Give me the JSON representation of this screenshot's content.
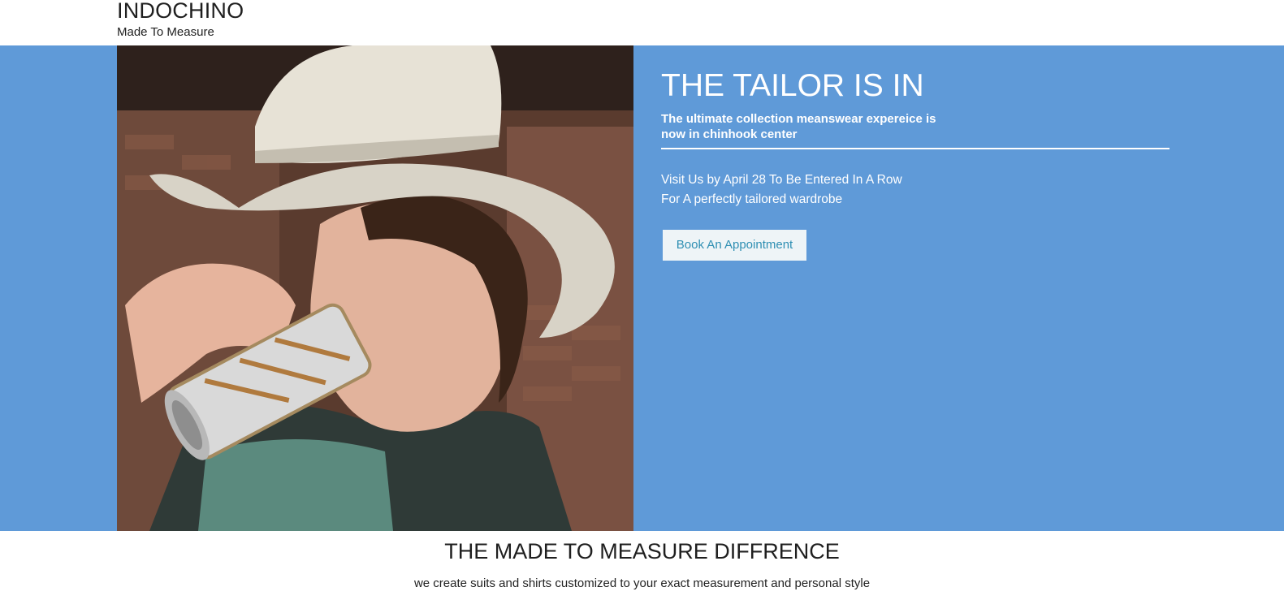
{
  "header": {
    "brand": "INDOCHINO",
    "tagline": "Made To Measure"
  },
  "hero": {
    "image_subject": "man-in-cowboy-hat-drinking-can",
    "title": "THE TAILOR IS IN",
    "subtitle": "The ultimate collection meanswear expereice is now in chinhook center",
    "lines": [
      "Visit Us by April 28 To Be Entered In A Row",
      "For A perfectly tailored wardrobe"
    ],
    "button_label": "Book An Appointment",
    "background_color": "#5f9ad8",
    "button_text_color": "#2f8fb3"
  },
  "section": {
    "title": "THE MADE TO MEASURE DIFFRENCE",
    "text": "we create suits and shirts customized to your exact measurement and personal style"
  }
}
